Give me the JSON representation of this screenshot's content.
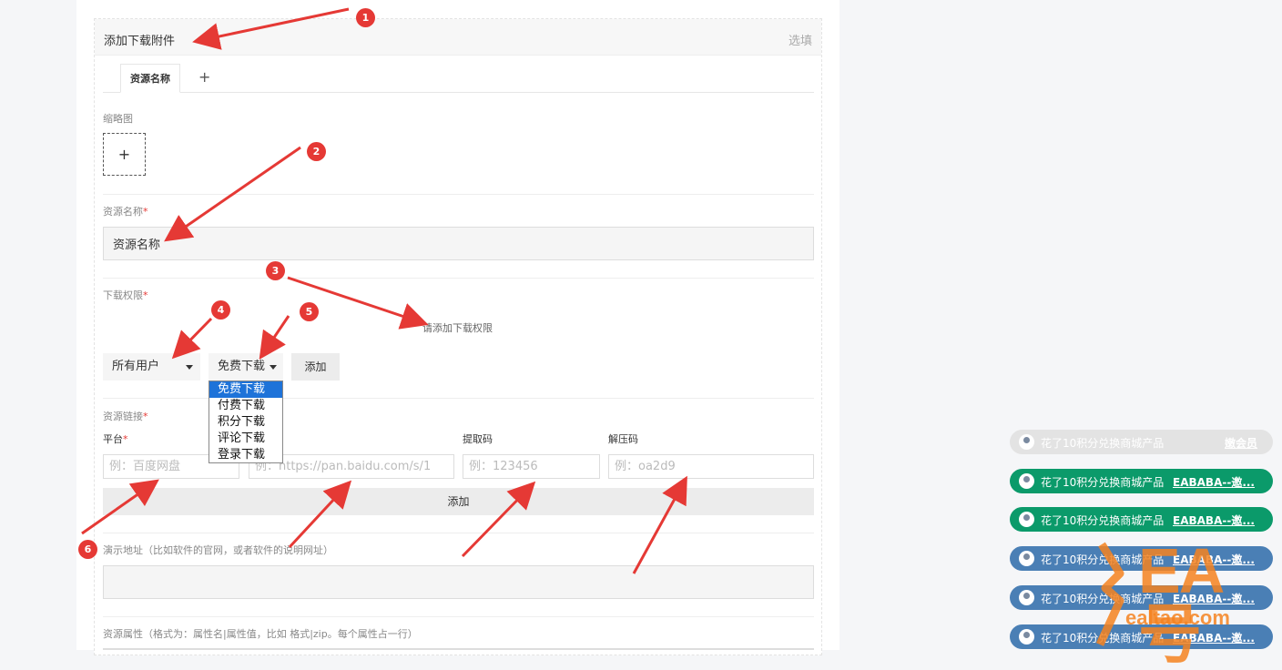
{
  "card": {
    "title": "添加下载附件",
    "optional": "选填"
  },
  "tabs": {
    "active_label": "资源名称",
    "add_symbol": "+"
  },
  "thumbnail": {
    "label": "缩略图",
    "add_symbol": "+"
  },
  "resource_name": {
    "label": "资源名称",
    "required": "*",
    "value": "资源名称"
  },
  "download_permission": {
    "label": "下载权限",
    "required": "*",
    "hint": "请添加下载权限",
    "user_select": "所有用户",
    "type_select": "免费下载",
    "add_button": "添加",
    "type_options": [
      "免费下载",
      "付费下载",
      "积分下载",
      "评论下载",
      "登录下载"
    ],
    "selected_option": "免费下载"
  },
  "resource_link": {
    "label": "资源链接",
    "required": "*",
    "platform_label": "平台",
    "platform_required": "*",
    "platform_placeholder": "例：百度网盘",
    "url_placeholder": "例：https://pan.baidu.com/s/1",
    "code_label": "提取码",
    "code_placeholder": "例：123456",
    "unzip_label": "解压码",
    "unzip_placeholder": "例：oa2d9",
    "add_button": "添加"
  },
  "demo_url": {
    "label": "演示地址（比如软件的官网，或者软件的说明网址）"
  },
  "resource_attr": {
    "label": "资源属性（格式为：属性名|属性值，比如 格式|zip。每个属性占一行）"
  },
  "annotations": [
    "1",
    "2",
    "3",
    "4",
    "5",
    "6"
  ],
  "notifications": [
    {
      "message": "花了10积分兑换商城产品",
      "link": "嫩会员",
      "color": "gray"
    },
    {
      "message": "花了10积分兑换商城产品",
      "link": "EABABA--邀...",
      "color": "green"
    },
    {
      "message": "花了10积分兑换商城产品",
      "link": "EABABA--邀...",
      "color": "green"
    },
    {
      "message": "花了10积分兑换商城产品",
      "link": "EABABA--邀...",
      "color": "blue"
    },
    {
      "message": "花了10积分兑换商城产品",
      "link": "EABABA--邀...",
      "color": "blue"
    },
    {
      "message": "花了10积分兑换商城产品",
      "link": "EABABA--邀...",
      "color": "blue"
    }
  ],
  "watermark": {
    "big": "EA号",
    "small": "ealtao.com"
  },
  "colors": {
    "annotation": "#e53935",
    "selected_option": "#1e73d9",
    "toast_green": "#0b9a6a",
    "toast_blue": "#4a7fb5"
  }
}
